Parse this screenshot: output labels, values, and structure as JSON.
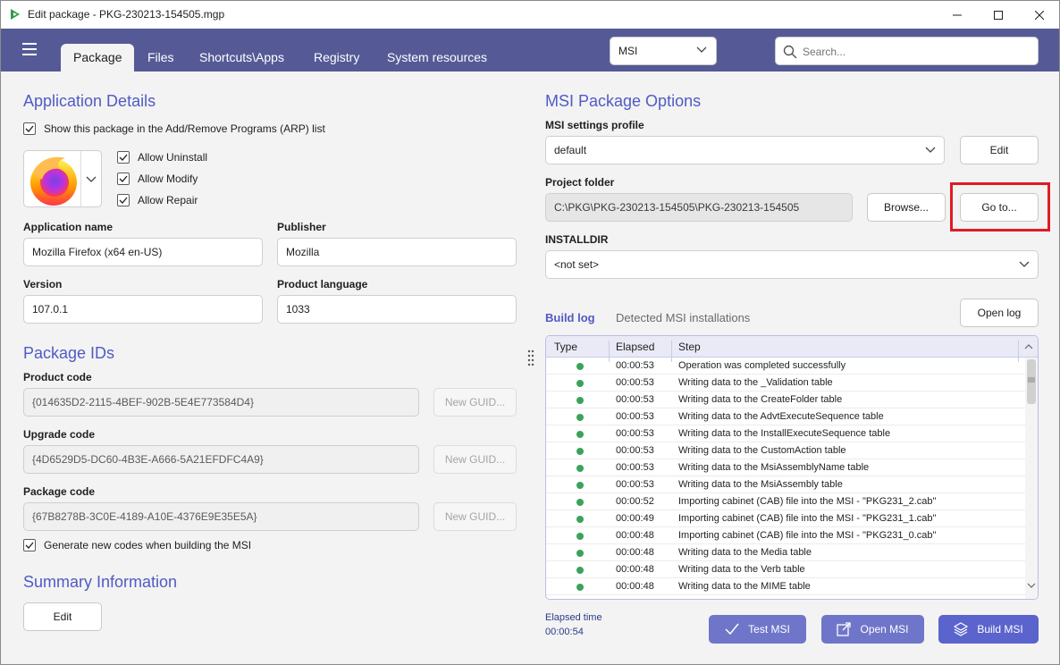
{
  "window": {
    "title": "Edit package - PKG-230213-154505.mgp"
  },
  "header": {
    "tabs": [
      "Package",
      "Files",
      "Shortcuts\\Apps",
      "Registry",
      "System resources"
    ],
    "build_type": "MSI",
    "search_placeholder": "Search..."
  },
  "app_details": {
    "title": "Application Details",
    "show_in_arp": "Show this package in the Add/Remove Programs (ARP) list",
    "allow_uninstall": "Allow Uninstall",
    "allow_modify": "Allow Modify",
    "allow_repair": "Allow Repair",
    "app_name_label": "Application name",
    "app_name": "Mozilla Firefox (x64 en-US)",
    "publisher_label": "Publisher",
    "publisher": "Mozilla",
    "version_label": "Version",
    "version": "107.0.1",
    "language_label": "Product language",
    "language": "1033"
  },
  "package_ids": {
    "title": "Package IDs",
    "product_code_label": "Product code",
    "product_code": "{014635D2-2115-4BEF-902B-5E4E773584D4}",
    "upgrade_code_label": "Upgrade code",
    "upgrade_code": "{4D6529D5-DC60-4B3E-A666-5A21EFDFC4A9}",
    "package_code_label": "Package code",
    "package_code": "{67B8278B-3C0E-4189-A10E-4376E9E35E5A}",
    "new_guid": "New GUID...",
    "generate_codes": "Generate new codes when building the MSI"
  },
  "summary": {
    "title": "Summary Information",
    "edit": "Edit"
  },
  "msi_options": {
    "title": "MSI Package Options",
    "profile_label": "MSI settings profile",
    "profile": "default",
    "edit": "Edit",
    "project_folder_label": "Project folder",
    "project_folder": "C:\\PKG\\PKG-230213-154505\\PKG-230213-154505",
    "browse": "Browse...",
    "goto": "Go to...",
    "installdir_label": "INSTALLDIR",
    "installdir": "<not set>"
  },
  "build_log": {
    "tab_log": "Build log",
    "tab_detected": "Detected MSI installations",
    "open_log": "Open log",
    "columns": [
      "Type",
      "Elapsed",
      "Step"
    ],
    "rows": [
      {
        "elapsed": "00:00:53",
        "step": "Operation was completed successfully"
      },
      {
        "elapsed": "00:00:53",
        "step": "Writing data to the _Validation table"
      },
      {
        "elapsed": "00:00:53",
        "step": "Writing data to the CreateFolder table"
      },
      {
        "elapsed": "00:00:53",
        "step": "Writing data to the AdvtExecuteSequence table"
      },
      {
        "elapsed": "00:00:53",
        "step": "Writing data to the InstallExecuteSequence table"
      },
      {
        "elapsed": "00:00:53",
        "step": "Writing data to the CustomAction table"
      },
      {
        "elapsed": "00:00:53",
        "step": "Writing data to the MsiAssemblyName table"
      },
      {
        "elapsed": "00:00:53",
        "step": "Writing data to the MsiAssembly table"
      },
      {
        "elapsed": "00:00:52",
        "step": "Importing cabinet (CAB) file into the MSI - \"PKG231_2.cab\""
      },
      {
        "elapsed": "00:00:49",
        "step": "Importing cabinet (CAB) file into the MSI - \"PKG231_1.cab\""
      },
      {
        "elapsed": "00:00:48",
        "step": "Importing cabinet (CAB) file into the MSI - \"PKG231_0.cab\""
      },
      {
        "elapsed": "00:00:48",
        "step": "Writing data to the Media table"
      },
      {
        "elapsed": "00:00:48",
        "step": "Writing data to the Verb table"
      },
      {
        "elapsed": "00:00:48",
        "step": "Writing data to the MIME table"
      }
    ],
    "status_color": "#3aa35a"
  },
  "footer": {
    "elapsed_label": "Elapsed time",
    "elapsed_value": "00:00:54",
    "test_msi": "Test MSI",
    "open_msi": "Open MSI",
    "build_msi": "Build MSI"
  }
}
